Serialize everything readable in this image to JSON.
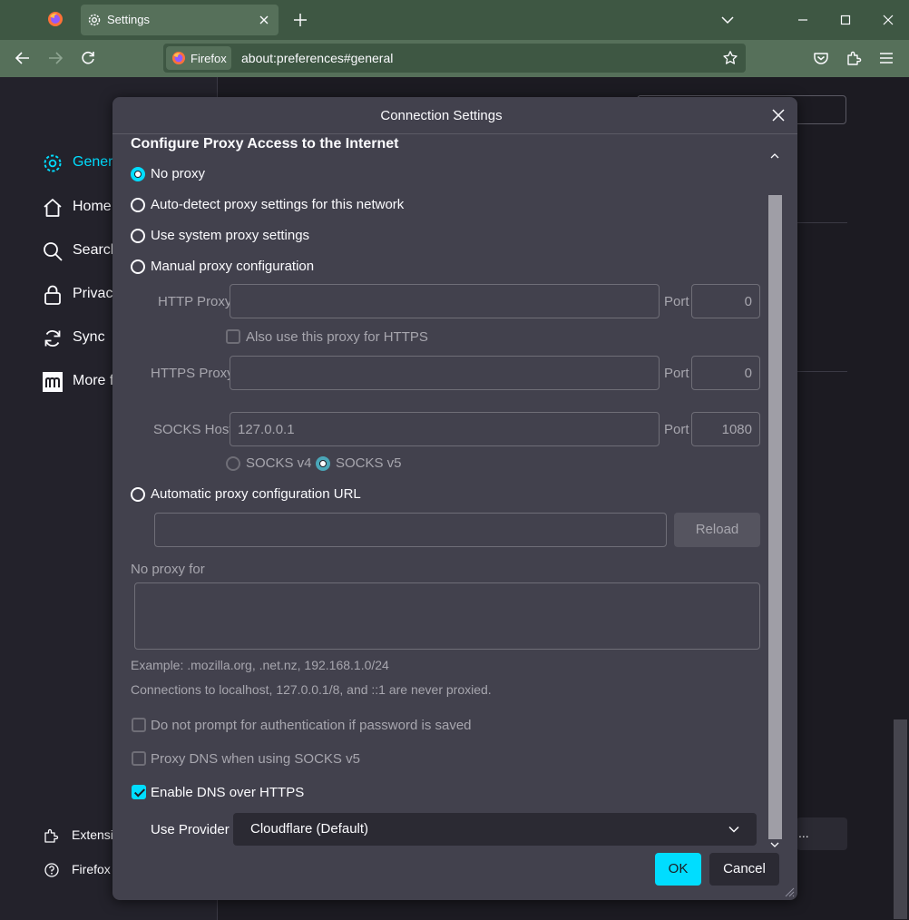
{
  "browser": {
    "tab_title": "Settings",
    "identity_label": "Firefox",
    "url": "about:preferences#general"
  },
  "settings_page": {
    "sidebar": [
      {
        "label": "General",
        "icon": "gear-icon",
        "active": true
      },
      {
        "label": "Home",
        "icon": "home-icon"
      },
      {
        "label": "Search",
        "icon": "search-icon"
      },
      {
        "label": "Privacy",
        "icon": "lock-icon"
      },
      {
        "label": "Sync",
        "icon": "sync-icon"
      },
      {
        "label": "More f",
        "icon": "mozilla-icon"
      }
    ],
    "sidebar_bottom": [
      {
        "label": "Extensio",
        "icon": "puzzle-icon"
      },
      {
        "label": "Firefox",
        "icon": "help-icon"
      }
    ],
    "partial_button": "..."
  },
  "dialog": {
    "title": "Connection Settings",
    "section_header": "Configure Proxy Access to the Internet",
    "proxy_options": {
      "no_proxy": "No proxy",
      "auto_detect": "Auto-detect proxy settings for this network",
      "system": "Use system proxy settings",
      "manual": "Manual proxy configuration",
      "auto_url": "Automatic proxy configuration URL"
    },
    "http_proxy_label": "HTTP Proxy",
    "http_proxy_value": "",
    "http_port_label": "Port",
    "http_port_value": "0",
    "also_https_label": "Also use this proxy for HTTPS",
    "https_proxy_label": "HTTPS Proxy",
    "https_proxy_value": "",
    "https_port_label": "Port",
    "https_port_value": "0",
    "socks_host_label": "SOCKS Host",
    "socks_host_value": "127.0.0.1",
    "socks_port_label": "Port",
    "socks_port_value": "1080",
    "socks_v4_label": "SOCKS v4",
    "socks_v5_label": "SOCKS v5",
    "auto_url_value": "",
    "reload_label": "Reload",
    "no_proxy_for_label": "No proxy for",
    "no_proxy_for_value": "",
    "example_text": "Example: .mozilla.org, .net.nz, 192.168.1.0/24",
    "localhost_text": "Connections to localhost, 127.0.0.1/8, and ::1 are never proxied.",
    "no_prompt_auth_label": "Do not prompt for authentication if password is saved",
    "proxy_dns_label": "Proxy DNS when using SOCKS v5",
    "enable_doh_label": "Enable DNS over HTTPS",
    "use_provider_label": "Use Provider",
    "provider_value": "Cloudflare (Default)",
    "ok_label": "OK",
    "cancel_label": "Cancel"
  },
  "colors": {
    "accent": "#00ddff",
    "dialog_bg": "#42414d",
    "chrome_green": "#56705a"
  }
}
